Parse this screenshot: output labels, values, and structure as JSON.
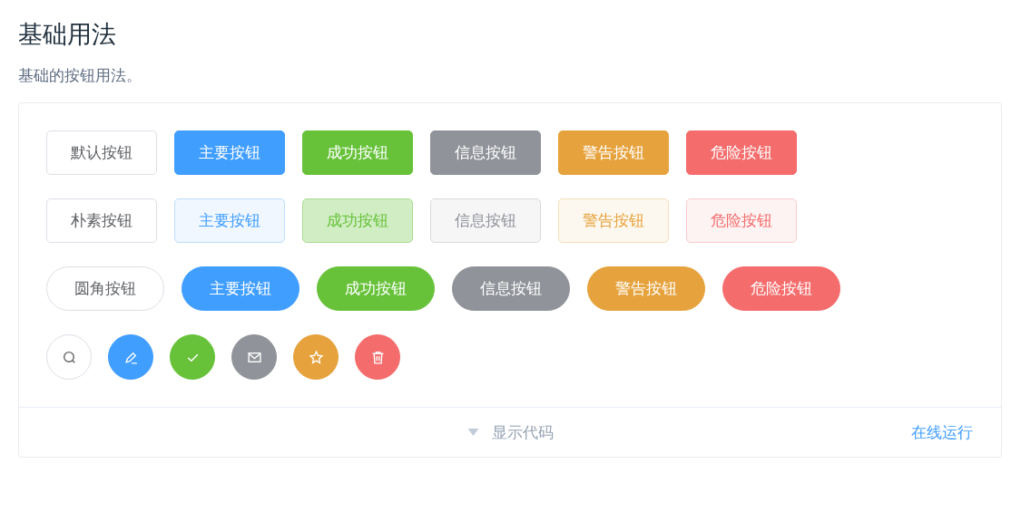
{
  "title": "基础用法",
  "description": "基础的按钮用法。",
  "rows": [
    {
      "kind": "normal",
      "buttons": [
        {
          "color": "#606266",
          "label": "默认按钮"
        },
        {
          "color": "#409eff",
          "label": "主要按钮"
        },
        {
          "color": "#67c23a",
          "label": "成功按钮"
        },
        {
          "color": "#909399",
          "label": "信息按钮"
        },
        {
          "color": "#e6a23c",
          "label": "警告按钮"
        },
        {
          "color": "#f56c6c",
          "label": "危险按钮"
        }
      ]
    },
    {
      "kind": "plain",
      "buttons": [
        {
          "color": "#606266",
          "label": "朴素按钮",
          "hovered": false
        },
        {
          "color": "#409eff",
          "label": "主要按钮",
          "hovered": false
        },
        {
          "color": "#67c23a",
          "label": "成功按钮",
          "hovered": true
        },
        {
          "color": "#909399",
          "label": "信息按钮",
          "hovered": false
        },
        {
          "color": "#e6a23c",
          "label": "警告按钮",
          "hovered": false
        },
        {
          "color": "#f56c6c",
          "label": "危险按钮",
          "hovered": false
        }
      ]
    },
    {
      "kind": "round",
      "buttons": [
        {
          "color": "#606266",
          "label": "圆角按钮"
        },
        {
          "color": "#409eff",
          "label": "主要按钮"
        },
        {
          "color": "#67c23a",
          "label": "成功按钮"
        },
        {
          "color": "#909399",
          "label": "信息按钮"
        },
        {
          "color": "#e6a23c",
          "label": "警告按钮"
        },
        {
          "color": "#f56c6c",
          "label": "危险按钮"
        }
      ]
    },
    {
      "kind": "circle",
      "buttons": [
        {
          "color": "#dcdfe6"
        },
        {
          "color": "#409eff"
        },
        {
          "color": "#67c23a"
        },
        {
          "color": "#909399"
        },
        {
          "color": "#e6a23c"
        },
        {
          "color": "#f56c6c"
        }
      ]
    }
  ],
  "footer": {
    "toggle_label": "显示代码",
    "run_link": "在线运行"
  }
}
